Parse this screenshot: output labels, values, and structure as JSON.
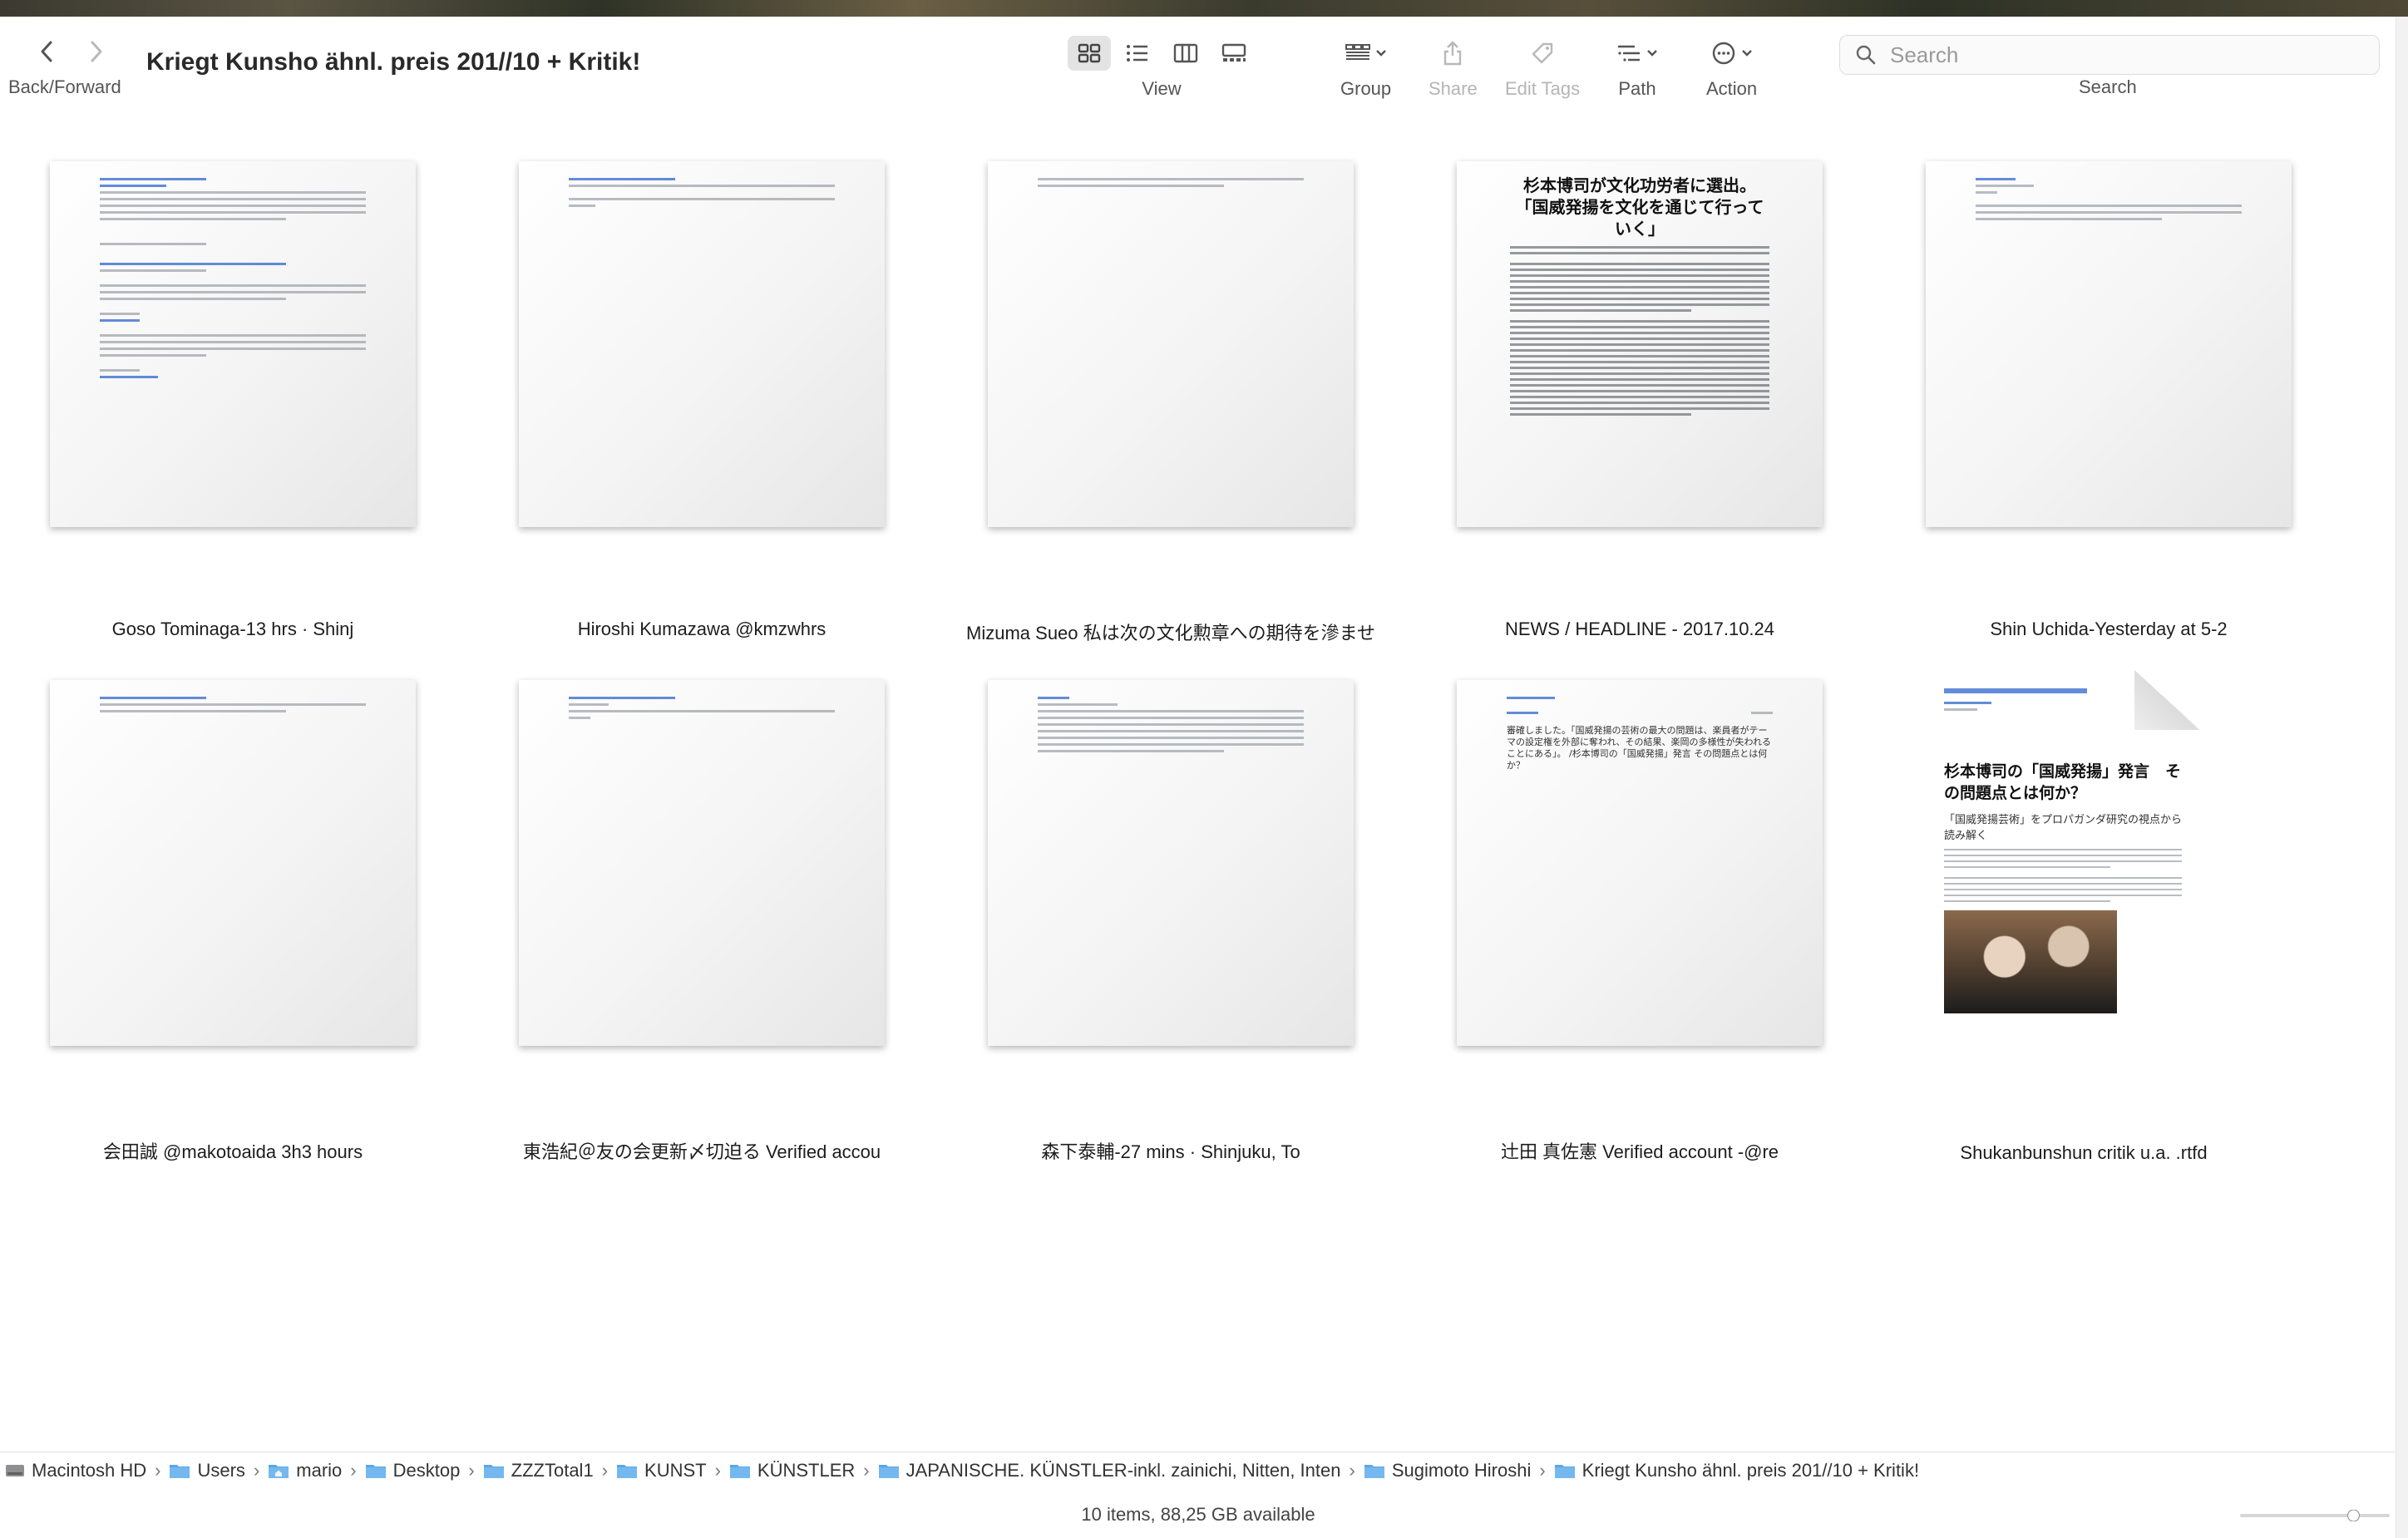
{
  "window": {
    "title": "Kriegt Kunsho ähnl. preis 201//10 + Kritik!"
  },
  "toolbar": {
    "back_forward_label": "Back/Forward",
    "view_label": "View",
    "group_label": "Group",
    "share_label": "Share",
    "edit_tags_label": "Edit Tags",
    "path_label": "Path",
    "action_label": "Action",
    "search_label": "Search",
    "search_placeholder": "Search",
    "active_view": "icon"
  },
  "files": [
    {
      "name": "Goso Tominaga-13 hrs · Shinj"
    },
    {
      "name": "Hiroshi Kumazawa @kmzwhrs"
    },
    {
      "name": "Mizuma Sueo 私は次の文化勲章への期待を滲ませ"
    },
    {
      "name": "NEWS / HEADLINE - 2017.10.24",
      "preview_heading_1": "杉本博司が文化功労者に選出。",
      "preview_heading_2": "「国威発揚を文化を通じて行っていく」"
    },
    {
      "name": "Shin Uchida-Yesterday at 5-2"
    },
    {
      "name": "会田誠 @makotoaida  3h3 hours"
    },
    {
      "name": "東浩紀＠友の会更新〆切迫る Verified accou"
    },
    {
      "name": "森下泰輔-27 mins · Shinjuku, To"
    },
    {
      "name": "辻田 真佐憲 Verified account -@re",
      "preview_text": "審確しました。「国威発揚の芸術の最大の問題は、楽員者がテーマの設定権を外部に奪われ、その結果、楽岡の多様性が失われることにある」。 /杉本博司の「国威発揚」発言 その問題点とは何か？"
    },
    {
      "name": "Shukanbunshun critik u.a. .rtfd",
      "preview_title": "杉本博司の「国威発揚」発言　その問題点とは何か？",
      "preview_sub": "「国威発揚芸術」をプロパガンダ研究の視点から読み解く"
    }
  ],
  "path": [
    {
      "label": "Macintosh HD",
      "icon": "hard-drive-icon"
    },
    {
      "label": "Users",
      "icon": "folder-icon"
    },
    {
      "label": "mario",
      "icon": "home-folder-icon"
    },
    {
      "label": "Desktop",
      "icon": "folder-icon"
    },
    {
      "label": "ZZZTotal1",
      "icon": "folder-icon"
    },
    {
      "label": "KUNST",
      "icon": "folder-icon"
    },
    {
      "label": "KÜNSTLER",
      "icon": "folder-icon"
    },
    {
      "label": "JAPANISCHE. KÜNSTLER-inkl. zainichi, Nitten, Inten",
      "icon": "folder-icon"
    },
    {
      "label": "Sugimoto Hiroshi",
      "icon": "folder-icon"
    },
    {
      "label": "Kriegt Kunsho ähnl. preis 201//10 + Kritik!",
      "icon": "folder-icon"
    }
  ],
  "status": {
    "text": "10 items, 88,25 GB available",
    "zoom_level": 0.78
  },
  "colors": {
    "accent": "#3b6fd0",
    "folder": "#5aa7e6",
    "selected_view_bg": "#e3e3e3"
  }
}
